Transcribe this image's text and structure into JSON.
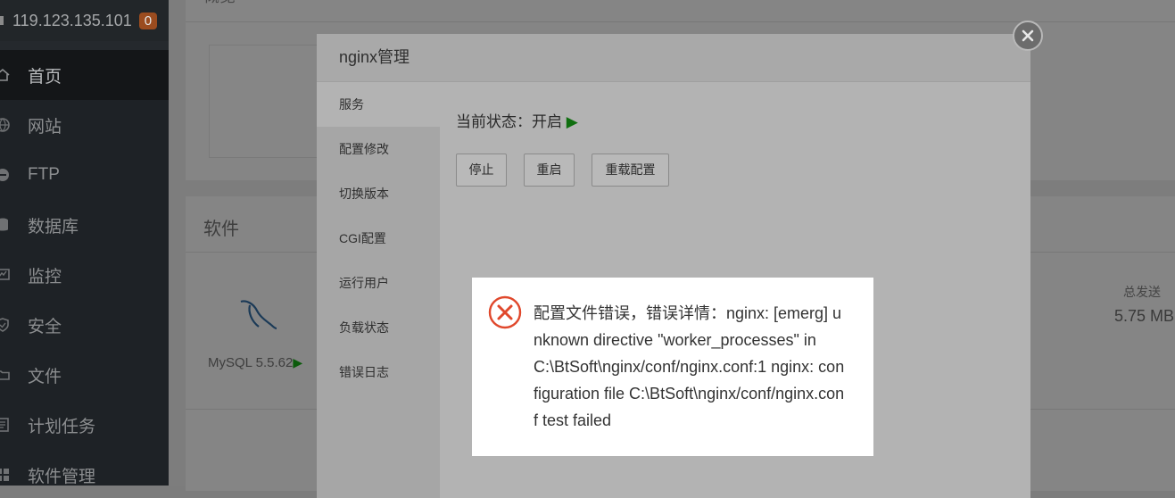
{
  "sidebar": {
    "ip": "119.123.135.101",
    "badge": "0",
    "items": [
      {
        "label": "首页",
        "icon": "home-icon"
      },
      {
        "label": "网站",
        "icon": "globe-icon"
      },
      {
        "label": "FTP",
        "icon": "ftp-icon"
      },
      {
        "label": "数据库",
        "icon": "database-icon"
      },
      {
        "label": "监控",
        "icon": "monitor-icon"
      },
      {
        "label": "安全",
        "icon": "shield-icon"
      },
      {
        "label": "文件",
        "icon": "folder-icon"
      },
      {
        "label": "计划任务",
        "icon": "task-icon"
      },
      {
        "label": "软件管理",
        "icon": "apps-icon"
      }
    ]
  },
  "main": {
    "card1_title": "概览",
    "software_title": "软件",
    "mysql_label": "MySQL 5.5.62",
    "send_label": "总发送",
    "send_value": "5.75 MB"
  },
  "modal": {
    "title": "nginx管理",
    "tabs": [
      "服务",
      "配置修改",
      "切换版本",
      "CGI配置",
      "运行用户",
      "负载状态",
      "错误日志"
    ],
    "status_text": "当前状态：开启",
    "buttons": {
      "stop": "停止",
      "restart": "重启",
      "reload": "重载配置"
    }
  },
  "message": {
    "text": "配置文件错误，错误详情：nginx: [emerg] unknown directive \"worker_processes\" in C:\\BtSoft\\nginx/conf/nginx.conf:1 nginx: configuration file C:\\BtSoft\\nginx/conf/nginx.conf test failed",
    "icon": "error-icon"
  },
  "colors": {
    "error": "#e0482c",
    "running": "#0f6e0f",
    "sidebar_bg": "#1e2226"
  }
}
